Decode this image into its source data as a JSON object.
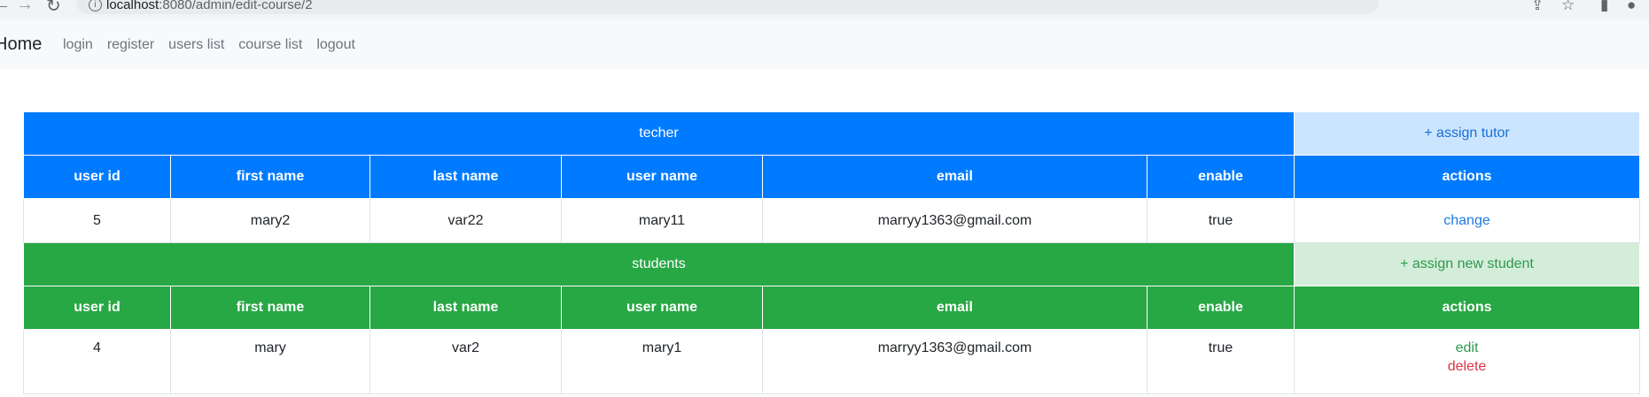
{
  "browser": {
    "url_host": "localhost",
    "url_rest": ":8080/admin/edit-course/2",
    "back_glyph": "←",
    "forward_glyph": "→",
    "reload_glyph": "↻",
    "info_glyph": "i",
    "share_glyph": "⇪",
    "star_glyph": "☆",
    "sidepanel_glyph": "▮",
    "profile_glyph": "●"
  },
  "navbar": {
    "brand": "Home",
    "links": [
      "login",
      "register",
      "users list",
      "course list",
      "logout"
    ]
  },
  "teacher": {
    "section_title": "techer",
    "assign_label": "+ assign tutor",
    "headers": [
      "user id",
      "first name",
      "last name",
      "user name",
      "email",
      "enable",
      "actions"
    ],
    "row": {
      "user_id": "5",
      "first_name": "mary2",
      "last_name": "var22",
      "user_name": "mary11",
      "email": "marryy1363@gmail.com",
      "enable": "true",
      "action": "change"
    }
  },
  "students": {
    "section_title": "students",
    "assign_label": "+ assign new student",
    "headers": [
      "user id",
      "first name",
      "last name",
      "user name",
      "email",
      "enable",
      "actions"
    ],
    "row": {
      "user_id": "4",
      "first_name": "mary",
      "last_name": "var2",
      "user_name": "mary1",
      "email": "marryy1363@gmail.com",
      "enable": "true",
      "action_edit": "edit",
      "action_delete": "delete"
    }
  },
  "colors": {
    "primary": "#007bff",
    "success": "#28a745",
    "danger": "#dc3545"
  }
}
